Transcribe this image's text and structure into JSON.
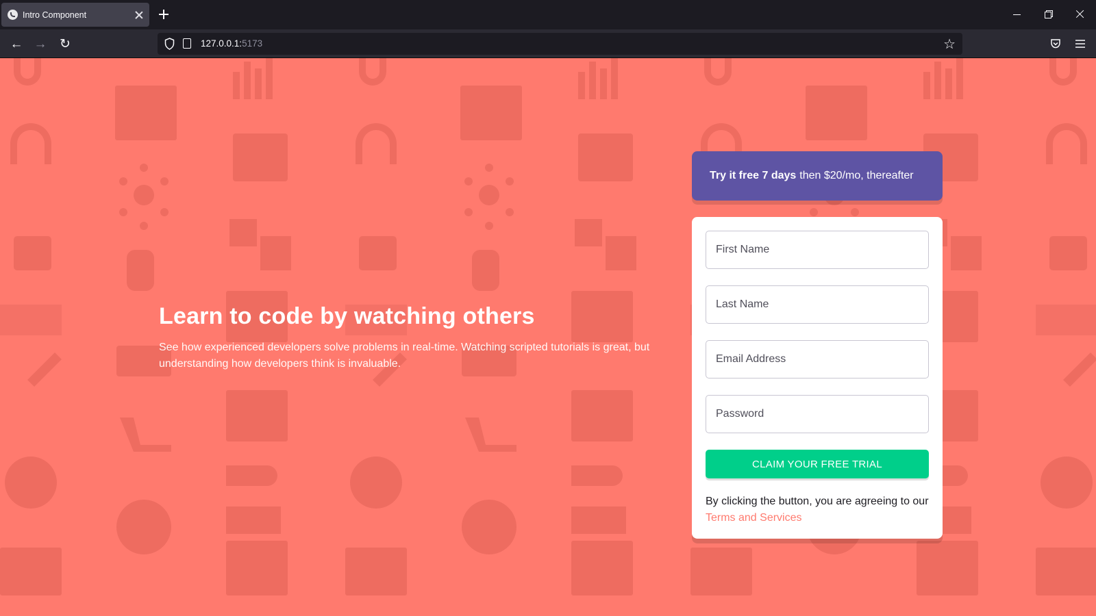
{
  "browser": {
    "tab_title": "Intro Component",
    "url_host": "127.0.0.1:",
    "url_port": "5173"
  },
  "hero": {
    "title": "Learn to code by watching others",
    "description": "See how experienced developers solve problems in real-time. Watching scripted tutorials is great, but understanding how developers think is invaluable."
  },
  "promo": {
    "bold": "Try it free 7 days",
    "rest": "then $20/mo, thereafter"
  },
  "form": {
    "first_name_placeholder": "First Name",
    "last_name_placeholder": "Last Name",
    "email_placeholder": "Email Address",
    "password_placeholder": "Password",
    "submit_label": "CLAIM YOUR FREE TRIAL",
    "terms_prefix": "By clicking the button, you are agreeing to our",
    "terms_link": "Terms and Services"
  },
  "colors": {
    "background": "#ff7a6e",
    "promo": "#5e54a4",
    "cta": "#00cf8a",
    "link": "#ff7a6e"
  }
}
